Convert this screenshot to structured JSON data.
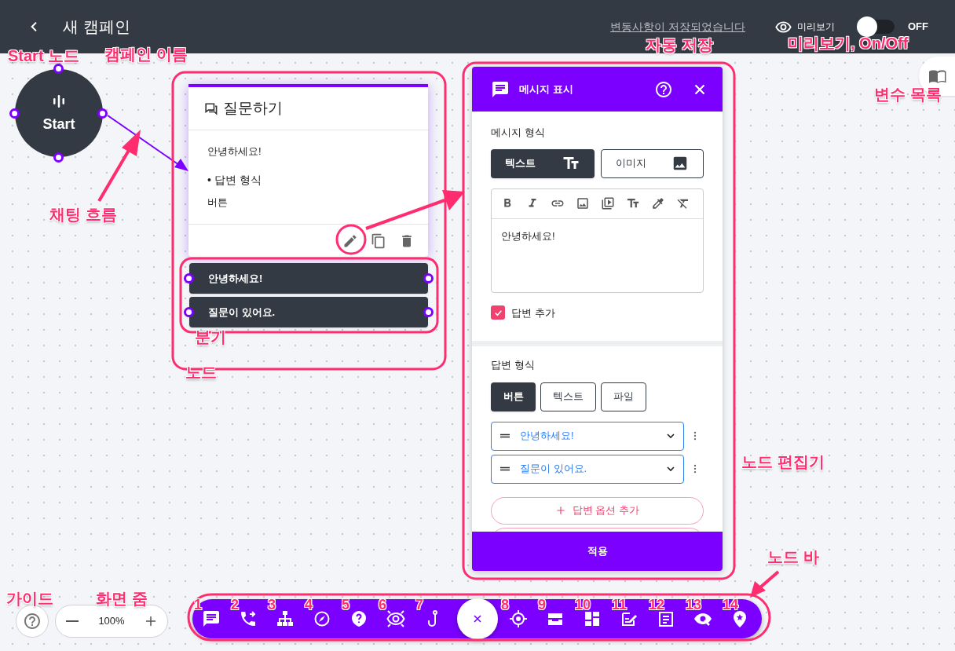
{
  "header": {
    "title": "새 캠페인",
    "save_status": "변동사항이 저장되었습니다",
    "preview_label": "미리보기",
    "preview_toggle": {
      "on": false,
      "label": "OFF"
    }
  },
  "start_node": {
    "label": "Start"
  },
  "node": {
    "title": "질문하기",
    "message": "안녕하세요!",
    "answer_format_label": "• 답변 형식",
    "answer_format": "버튼",
    "branches": [
      "안녕하세요!",
      "질문이 있어요."
    ]
  },
  "editor": {
    "title": "메시지 표시",
    "message_format_label": "메시지 형식",
    "message_formats": [
      {
        "label": "텍스트",
        "selected": true
      },
      {
        "label": "이미지",
        "selected": false
      }
    ],
    "message_text": "안녕하세요!",
    "add_answer": {
      "label": "답변 추가",
      "checked": true
    },
    "answer_format_label": "답변 형식",
    "answer_formats": [
      {
        "label": "버튼",
        "selected": true
      },
      {
        "label": "텍스트",
        "selected": false
      },
      {
        "label": "파일",
        "selected": false
      }
    ],
    "answer_options": [
      "안녕하세요!",
      "질문이 있어요."
    ],
    "add_option_button": "답변 옵션 추가",
    "apply_button": "적용"
  },
  "zoom": {
    "value": "100%"
  },
  "annotations": {
    "callouts": [
      "Start 노드",
      "캠페인 이름",
      "채팅 흐름",
      "자동 저장",
      "미리보기, On/Off",
      "변수 목록",
      "분기",
      "노드",
      "노드 편집기",
      "노드 바",
      "가이드",
      "화면 줌"
    ],
    "node_bar_numbers": [
      "1",
      "2",
      "3",
      "4",
      "5",
      "6",
      "7",
      "8",
      "9",
      "10",
      "11",
      "12",
      "13",
      "14"
    ]
  }
}
